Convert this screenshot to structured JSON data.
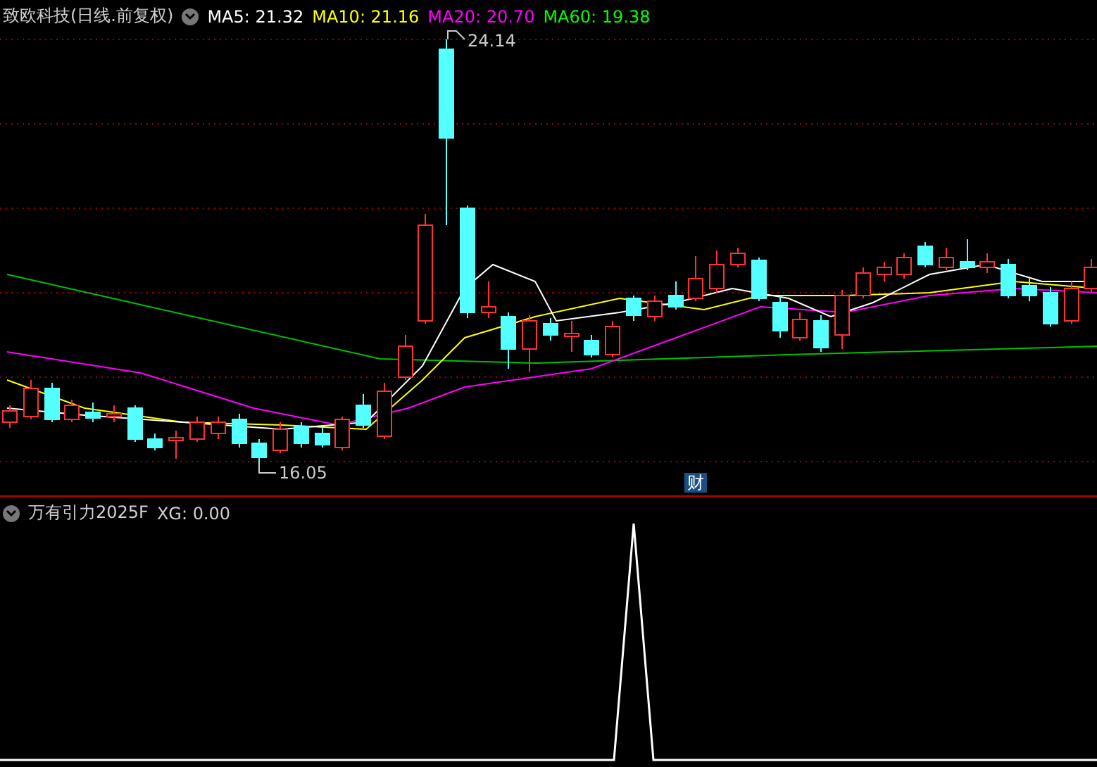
{
  "main_panel": {
    "title": "致欧科技(日线.前复权)",
    "moving_averages": [
      {
        "label": "MA5: 21.32",
        "color": "#ffffff"
      },
      {
        "label": "MA10: 21.16",
        "color": "#ffff00"
      },
      {
        "label": "MA20: 20.70",
        "color": "#ff00ff"
      },
      {
        "label": "MA60: 19.38",
        "color": "#00ff00"
      }
    ],
    "high_label": "24.14",
    "low_label": "16.05",
    "event_badge": "财"
  },
  "indicator_panel": {
    "name": "万有引力2025F",
    "reading": "XG: 0.00"
  }
}
